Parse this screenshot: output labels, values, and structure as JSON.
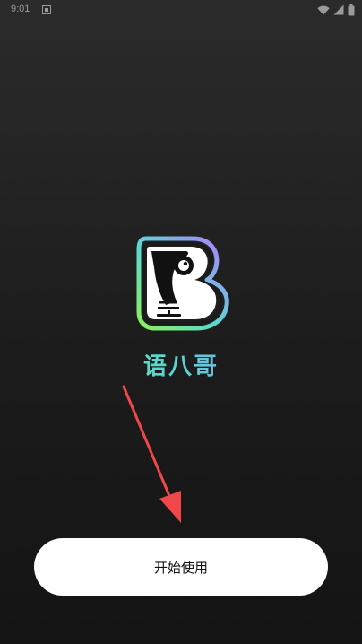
{
  "status_bar": {
    "time": "9:01",
    "notification_icon": "notification-box-icon",
    "wifi_icon": "wifi-icon",
    "cellular_icon": "cellular-signal-icon",
    "battery_icon": "battery-icon"
  },
  "app": {
    "name": "语八哥",
    "logo_icon": "b-microphone-logo-icon",
    "name_gradient": [
      "#7cf26a",
      "#58d7d0",
      "#a57dfa"
    ]
  },
  "guide_arrow": {
    "icon": "red-arrow-icon",
    "color": "#f0474b"
  },
  "start_button": {
    "label": "开始使用"
  }
}
